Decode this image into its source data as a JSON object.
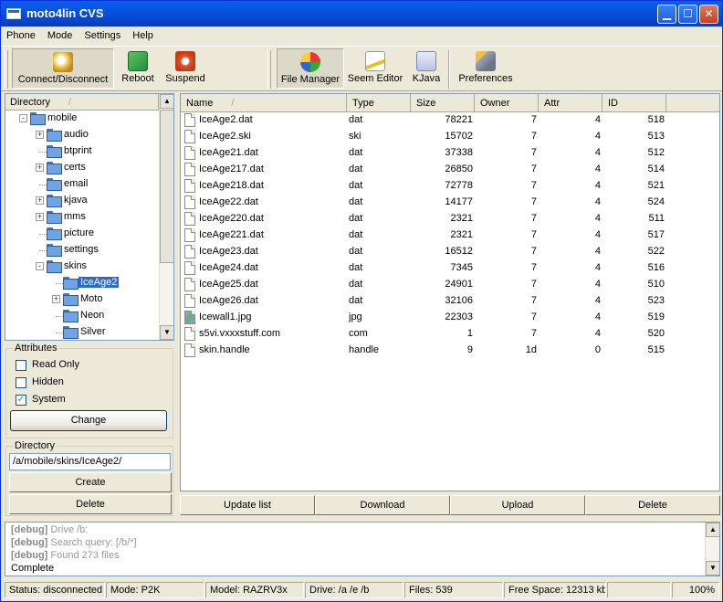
{
  "window": {
    "title": "moto4lin CVS"
  },
  "menu": [
    "Phone",
    "Mode",
    "Settings",
    "Help"
  ],
  "toolbar": {
    "left": [
      {
        "label": "Connect/Disconnect",
        "icon": "connect-icon",
        "pressed": true
      },
      {
        "label": "Reboot",
        "icon": "reboot-icon"
      },
      {
        "label": "Suspend",
        "icon": "suspend-icon"
      }
    ],
    "right": [
      {
        "label": "File Manager",
        "icon": "file-manager-icon",
        "pressed": true
      },
      {
        "label": "Seem Editor",
        "icon": "seem-editor-icon"
      },
      {
        "label": "KJava",
        "icon": "kjava-icon"
      },
      {
        "label": "Preferences",
        "icon": "preferences-icon"
      }
    ]
  },
  "tree": {
    "header": "Directory",
    "sort_mark": "/",
    "items": [
      {
        "label": "mobile",
        "level": 0,
        "expander": "-"
      },
      {
        "label": "audio",
        "level": 1,
        "expander": "+"
      },
      {
        "label": "btprint",
        "level": 1,
        "expander": ""
      },
      {
        "label": "certs",
        "level": 1,
        "expander": "+"
      },
      {
        "label": "email",
        "level": 1,
        "expander": ""
      },
      {
        "label": "kjava",
        "level": 1,
        "expander": "+"
      },
      {
        "label": "mms",
        "level": 1,
        "expander": "+"
      },
      {
        "label": "picture",
        "level": 1,
        "expander": ""
      },
      {
        "label": "settings",
        "level": 1,
        "expander": ""
      },
      {
        "label": "skins",
        "level": 1,
        "expander": "-"
      },
      {
        "label": "IceAge2",
        "level": 2,
        "expander": "",
        "selected": true
      },
      {
        "label": "Moto",
        "level": 2,
        "expander": "+"
      },
      {
        "label": "Neon",
        "level": 2,
        "expander": ""
      },
      {
        "label": "Silver",
        "level": 2,
        "expander": ""
      }
    ]
  },
  "attributes": {
    "title": "Attributes",
    "read_only": {
      "label": "Read Only",
      "checked": false
    },
    "hidden": {
      "label": "Hidden",
      "checked": false
    },
    "system": {
      "label": "System",
      "checked": true
    },
    "change_label": "Change"
  },
  "directory_box": {
    "title": "Directory",
    "path": "/a/mobile/skins/IceAge2/",
    "create_label": "Create",
    "delete_label": "Delete"
  },
  "filelist": {
    "columns": [
      "Name",
      "Type",
      "Size",
      "Owner",
      "Attr",
      "ID"
    ],
    "sort_mark": "/",
    "rows": [
      {
        "name": "IceAge2.dat",
        "type": "dat",
        "size": "78221",
        "owner": "7",
        "attr": "4",
        "id": "518"
      },
      {
        "name": "IceAge2.ski",
        "type": "ski",
        "size": "15702",
        "owner": "7",
        "attr": "4",
        "id": "513"
      },
      {
        "name": "IceAge21.dat",
        "type": "dat",
        "size": "37338",
        "owner": "7",
        "attr": "4",
        "id": "512"
      },
      {
        "name": "IceAge217.dat",
        "type": "dat",
        "size": "26850",
        "owner": "7",
        "attr": "4",
        "id": "514"
      },
      {
        "name": "IceAge218.dat",
        "type": "dat",
        "size": "72778",
        "owner": "7",
        "attr": "4",
        "id": "521"
      },
      {
        "name": "IceAge22.dat",
        "type": "dat",
        "size": "14177",
        "owner": "7",
        "attr": "4",
        "id": "524"
      },
      {
        "name": "IceAge220.dat",
        "type": "dat",
        "size": "2321",
        "owner": "7",
        "attr": "4",
        "id": "511"
      },
      {
        "name": "IceAge221.dat",
        "type": "dat",
        "size": "2321",
        "owner": "7",
        "attr": "4",
        "id": "517"
      },
      {
        "name": "IceAge23.dat",
        "type": "dat",
        "size": "16512",
        "owner": "7",
        "attr": "4",
        "id": "522"
      },
      {
        "name": "IceAge24.dat",
        "type": "dat",
        "size": "7345",
        "owner": "7",
        "attr": "4",
        "id": "516"
      },
      {
        "name": "IceAge25.dat",
        "type": "dat",
        "size": "24901",
        "owner": "7",
        "attr": "4",
        "id": "510"
      },
      {
        "name": "IceAge26.dat",
        "type": "dat",
        "size": "32106",
        "owner": "7",
        "attr": "4",
        "id": "523"
      },
      {
        "name": "Icewall1.jpg",
        "type": "jpg",
        "size": "22303",
        "owner": "7",
        "attr": "4",
        "id": "519",
        "icon": "image"
      },
      {
        "name": "s5vi.vxxxstuff.com",
        "type": "com",
        "size": "1",
        "owner": "7",
        "attr": "4",
        "id": "520"
      },
      {
        "name": "skin.handle",
        "type": "handle",
        "size": "9",
        "owner": "1d",
        "attr": "0",
        "id": "515"
      }
    ]
  },
  "actions": [
    "Update list",
    "Download",
    "Upload",
    "Delete"
  ],
  "log": [
    {
      "tag": "[debug]",
      "text": "Drive /b:"
    },
    {
      "tag": "[debug]",
      "text": "Search query: [/b/*]"
    },
    {
      "tag": "[debug]",
      "text": "Found 273 files"
    },
    {
      "tag": "",
      "text": "Complete"
    }
  ],
  "status": {
    "status": "Status: disconnected",
    "mode": "Mode: P2K",
    "model": "Model: RAZRV3x",
    "drive": "Drive: /a /e /b",
    "files": "Files: 539",
    "free_space": "Free Space: 12313 kb",
    "progress": "100%"
  },
  "colors": {
    "title_bar": "#0a5ee9",
    "selection": "#316ac5",
    "checkbox_mark": "#21a121"
  }
}
